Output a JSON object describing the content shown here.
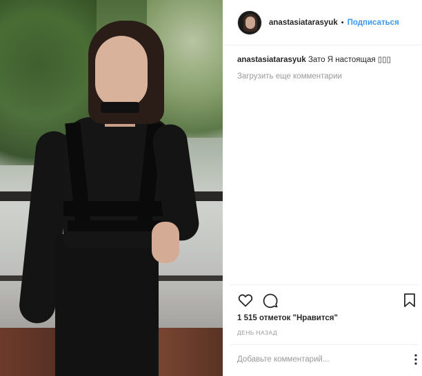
{
  "post": {
    "image_alt": "photo"
  },
  "header": {
    "username": "anastasiatarasyuk",
    "separator": "•",
    "follow_label": "Подписаться"
  },
  "comments": {
    "caption_user": "anastasiatarasyuk",
    "caption_text": "Зато Я настоящая ▯▯▯",
    "load_more_label": "Загрузить еще комментарии"
  },
  "actions": {
    "like_icon": "heart-icon",
    "comment_icon": "comment-icon",
    "save_icon": "bookmark-icon"
  },
  "stats": {
    "likes_text": "1 515 отметок \"Нравится\"",
    "time_text": "День назад"
  },
  "compose": {
    "placeholder": "Добавьте комментарий..."
  },
  "colors": {
    "link": "#3897f0",
    "muted": "#999999",
    "text": "#262626"
  }
}
